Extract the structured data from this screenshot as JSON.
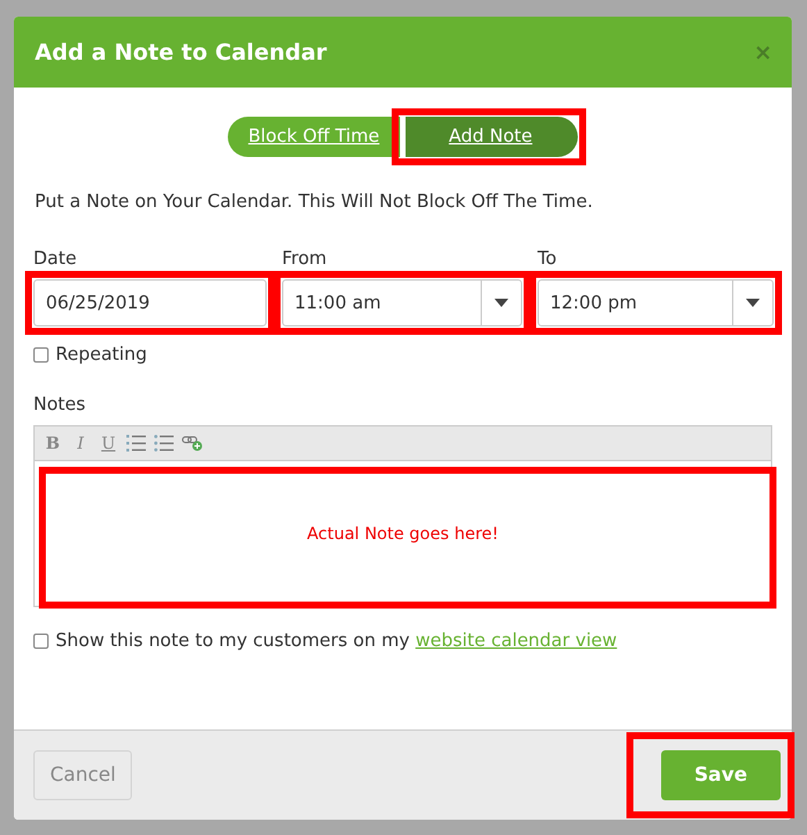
{
  "dialog": {
    "title": "Add a Note to Calendar",
    "close": "×"
  },
  "tabs": [
    {
      "label": "Block Off Time",
      "selected": false,
      "highlighted": false
    },
    {
      "label": "Add Note",
      "selected": true,
      "highlighted": true
    }
  ],
  "description": "Put a Note on Your Calendar. This Will Not Block Off The Time.",
  "fields": [
    {
      "kind": "text",
      "label": "Date",
      "value": "06/25/2019",
      "highlighted": true
    },
    {
      "kind": "select",
      "label": "From",
      "value": "11:00 am",
      "highlighted": true
    },
    {
      "kind": "select",
      "label": "To",
      "value": "12:00 pm",
      "highlighted": true
    }
  ],
  "repeating": {
    "label": "Repeating",
    "checked": false
  },
  "notes": {
    "label": "Notes",
    "toolbar": [
      {
        "kind": "bold",
        "glyph": "B"
      },
      {
        "kind": "italic",
        "glyph": "I"
      },
      {
        "kind": "underline",
        "glyph": "U"
      },
      {
        "kind": "ordered-list"
      },
      {
        "kind": "bullet-list"
      },
      {
        "kind": "link"
      }
    ],
    "value": "Actual Note goes here!",
    "highlighted": true
  },
  "show_to_customers": {
    "text": "Show this note to my customers on my ",
    "link": "website calendar view",
    "checked": false
  },
  "buttons": [
    {
      "kind": "secondary",
      "label": "Cancel",
      "highlighted": false
    },
    {
      "kind": "primary",
      "label": "Save",
      "highlighted": true
    }
  ]
}
